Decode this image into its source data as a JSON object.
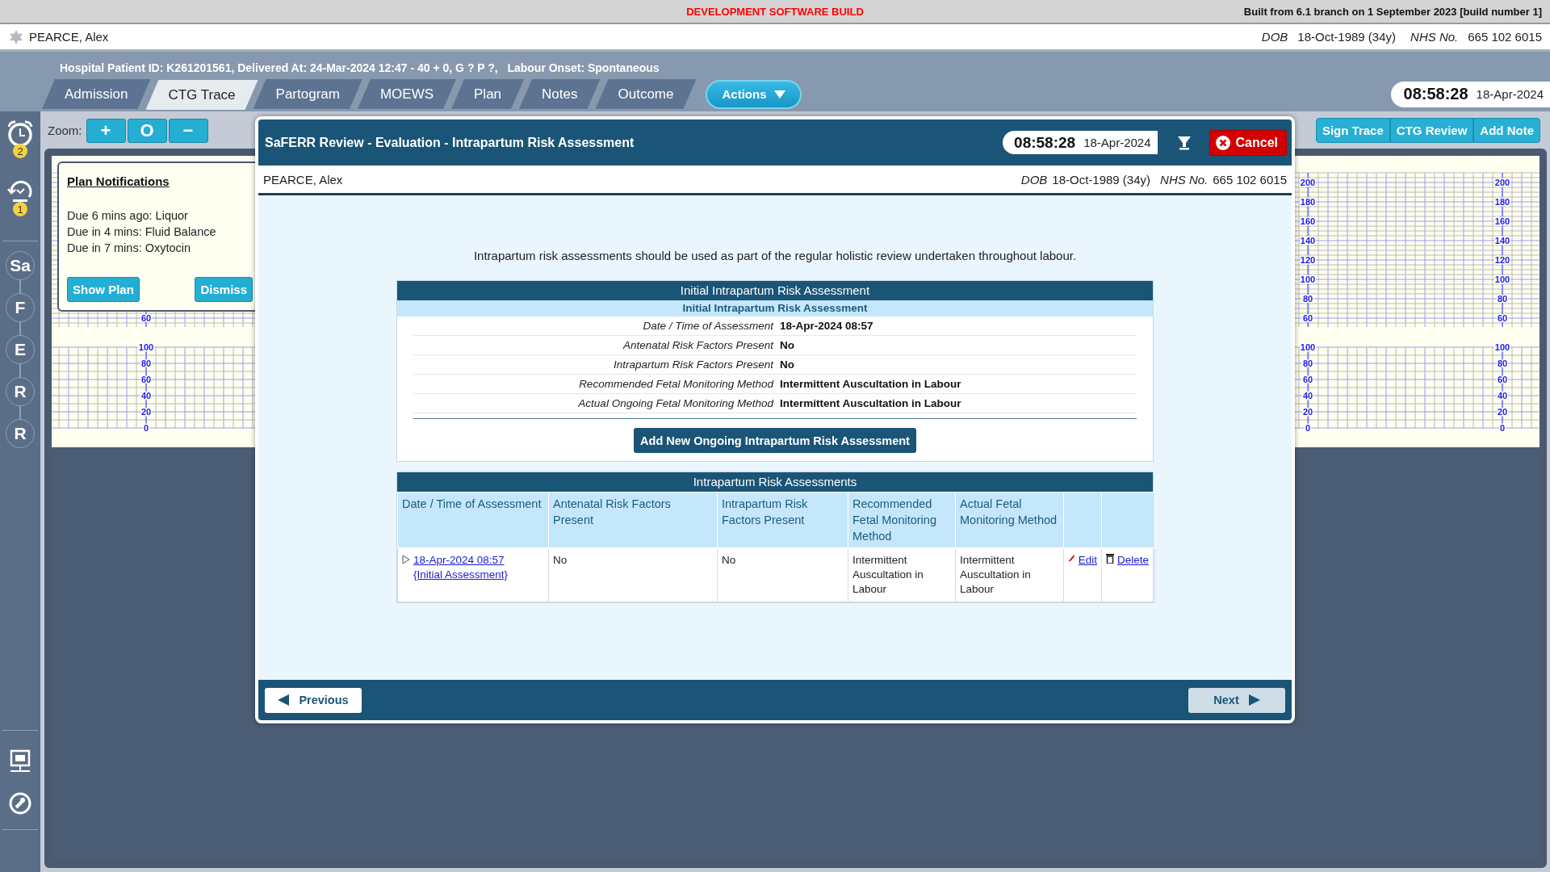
{
  "build_bar": {
    "notice": "DEVELOPMENT SOFTWARE BUILD",
    "build_info": "Built from 6.1 branch on 1 September 2023 [build number 1]"
  },
  "patient": {
    "name": "PEARCE, Alex",
    "dob_label": "DOB",
    "dob": "18-Oct-1989 (34y)",
    "nhs_label": "NHS No.",
    "nhs": "665 102 6015"
  },
  "episode_info": "Hospital Patient ID: K261201561, Delivered At: 24-Mar-2024 12:47 - 40 + 0, G ? P ?,   Labour Onset: Spontaneous",
  "tabs": [
    {
      "label": "Admission",
      "selected": false
    },
    {
      "label": "CTG Trace",
      "selected": true
    },
    {
      "label": "Partogram",
      "selected": false
    },
    {
      "label": "MOEWS",
      "selected": false
    },
    {
      "label": "Plan",
      "selected": false
    },
    {
      "label": "Notes",
      "selected": false
    },
    {
      "label": "Outcome",
      "selected": false
    }
  ],
  "actions_button": {
    "label": "Actions"
  },
  "clock": {
    "time": "08:58:28",
    "date": "18-Apr-2024"
  },
  "sidebar": {
    "alerts": [
      {
        "kind": "alarm",
        "badge": "2"
      },
      {
        "kind": "history",
        "badge": "1"
      }
    ],
    "steps": [
      "Sa",
      "F",
      "E",
      "R",
      "R"
    ],
    "tools": [
      {
        "kind": "presentation"
      },
      {
        "kind": "search"
      }
    ]
  },
  "zoom": {
    "label": "Zoom:",
    "buttons": [
      "+",
      "O",
      "−"
    ]
  },
  "trace_actions": [
    "Sign Trace",
    "CTG Review",
    "Add Note"
  ],
  "ctg_axes": [
    {
      "upper": [
        "60"
      ],
      "lower": [
        "100",
        "80",
        "60",
        "40",
        "20",
        "0"
      ]
    },
    {
      "upper": [
        "200",
        "180",
        "160",
        "140",
        "120",
        "100",
        "80",
        "60"
      ],
      "lower": [
        "100",
        "80",
        "60",
        "40",
        "20",
        "0"
      ]
    },
    {
      "upper": [
        "200",
        "180",
        "160",
        "140",
        "120",
        "100",
        "80",
        "60"
      ],
      "lower": [
        "100",
        "80",
        "60",
        "40",
        "20",
        "0"
      ]
    }
  ],
  "notifications": {
    "title": "Plan Notifications",
    "items": [
      "Due 6 mins ago: Liquor",
      "Due in 4 mins: Fluid Balance",
      "Due in 7 mins: Oxytocin"
    ],
    "buttons": [
      "Show Plan",
      "Dismiss"
    ]
  },
  "dialog": {
    "title": "SaFERR Review - Evaluation - Intrapartum Risk Assessment",
    "clock": {
      "time": "08:58:28",
      "date": "18-Apr-2024"
    },
    "cancel": "Cancel",
    "patient": {
      "name": "PEARCE, Alex",
      "dob_label": "DOB",
      "dob": "18-Oct-1989 (34y)",
      "nhs_label": "NHS No.",
      "nhs": "665 102 6015"
    },
    "intro": "Intrapartum risk assessments should be used as part of the regular holistic review undertaken throughout labour.",
    "initial_assessment": {
      "title": "Initial Intrapartum Risk Assessment",
      "subtitle": "Initial Intrapartum Risk Assessment",
      "fields": [
        {
          "label": "Date / Time of Assessment",
          "value": "18-Apr-2024 08:57"
        },
        {
          "label": "Antenatal Risk Factors Present",
          "value": "No"
        },
        {
          "label": "Intrapartum Risk Factors Present",
          "value": "No"
        },
        {
          "label": "Recommended Fetal Monitoring Method",
          "value": "Intermittent Auscultation in Labour"
        },
        {
          "label": "Actual Ongoing Fetal Monitoring Method",
          "value": "Intermittent Auscultation in Labour"
        }
      ],
      "add_button": "Add New Ongoing Intrapartum Risk Assessment"
    },
    "assessments_table": {
      "title": "Intrapartum Risk Assessments",
      "columns": [
        "Date / Time of Assessment",
        "Antenatal Risk Factors Present",
        "Intrapartum Risk Factors Present",
        "Recommended Fetal Monitoring Method",
        "Actual Fetal Monitoring Method"
      ],
      "rows": [
        {
          "expanded": false,
          "date": "18-Apr-2024 08:57",
          "note": "{Initial Assessment}",
          "antenatal": "No",
          "intrapartum": "No",
          "recommended": "Intermittent Auscultation in Labour",
          "actual": "Intermittent Auscultation in Labour",
          "edit": "Edit",
          "delete": "Delete"
        }
      ]
    },
    "footer": [
      {
        "label": "Previous",
        "kind": "back",
        "disabled": false
      },
      {
        "label": "Next",
        "kind": "forward",
        "disabled": true
      }
    ]
  }
}
